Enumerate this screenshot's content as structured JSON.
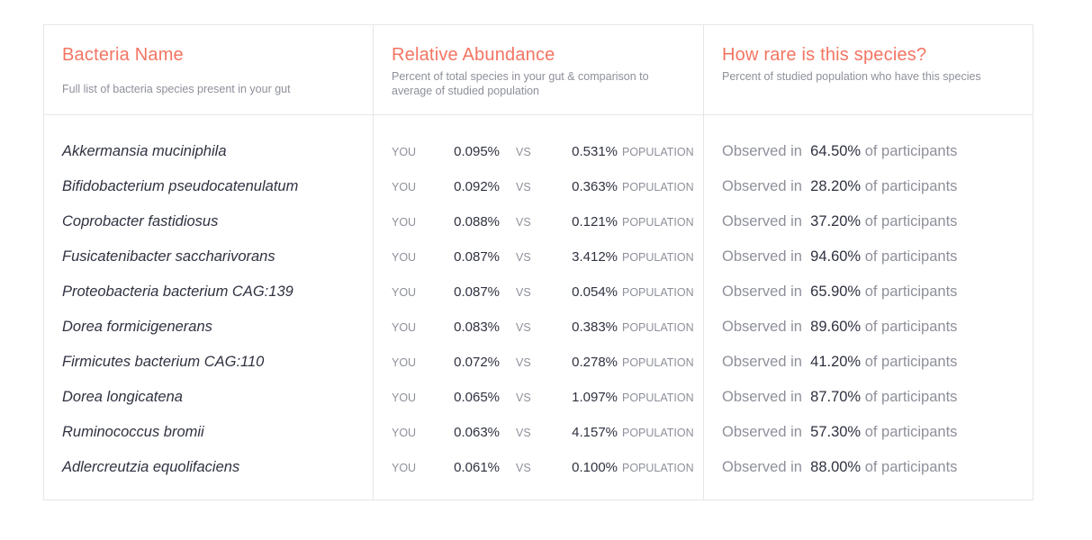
{
  "headers": {
    "name": {
      "title": "Bacteria Name",
      "subtitle": "Full list of bacteria species present in your gut"
    },
    "abundance": {
      "title": "Relative Abundance",
      "subtitle": "Percent of total species in your gut & comparison to average of studied population"
    },
    "rarity": {
      "title": "How rare is this species?",
      "subtitle": "Percent of studied population who have this species"
    }
  },
  "labels": {
    "you": "YOU",
    "vs": "VS",
    "population": "POPULATION",
    "observed_in": "Observed in",
    "of_participants": "of participants"
  },
  "rows": [
    {
      "name": "Akkermansia muciniphila",
      "you": "0.095%",
      "population": "0.531%",
      "observed": "64.50%"
    },
    {
      "name": "Bifidobacterium pseudocatenulatum",
      "you": "0.092%",
      "population": "0.363%",
      "observed": "28.20%"
    },
    {
      "name": "Coprobacter fastidiosus",
      "you": "0.088%",
      "population": "0.121%",
      "observed": "37.20%"
    },
    {
      "name": "Fusicatenibacter saccharivorans",
      "you": "0.087%",
      "population": "3.412%",
      "observed": "94.60%"
    },
    {
      "name": "Proteobacteria bacterium CAG:139",
      "you": "0.087%",
      "population": "0.054%",
      "observed": "65.90%"
    },
    {
      "name": "Dorea formicigenerans",
      "you": "0.083%",
      "population": "0.383%",
      "observed": "89.60%"
    },
    {
      "name": "Firmicutes bacterium CAG:110",
      "you": "0.072%",
      "population": "0.278%",
      "observed": "41.20%"
    },
    {
      "name": "Dorea longicatena",
      "you": "0.065%",
      "population": "1.097%",
      "observed": "87.70%"
    },
    {
      "name": "Ruminococcus bromii",
      "you": "0.063%",
      "population": "4.157%",
      "observed": "57.30%"
    },
    {
      "name": "Adlercreutzia equolifaciens",
      "you": "0.061%",
      "population": "0.100%",
      "observed": "88.00%"
    }
  ]
}
